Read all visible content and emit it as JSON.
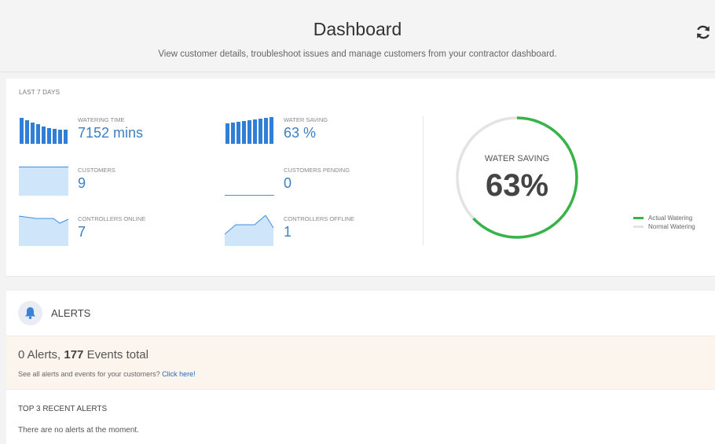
{
  "header": {
    "title": "Dashboard",
    "subtitle": "View customer details, troubleshoot issues and manage customers from your contractor dashboard."
  },
  "stats": {
    "period_label": "LAST 7 DAYS",
    "watering_time": {
      "label": "WATERING TIME",
      "value": "7152 mins"
    },
    "water_saving": {
      "label": "WATER SAVING",
      "value": "63 %"
    },
    "customers": {
      "label": "CUSTOMERS",
      "value": "9"
    },
    "customers_pending": {
      "label": "CUSTOMERS PENDING",
      "value": "0"
    },
    "controllers_online": {
      "label": "CONTROLLERS ONLINE",
      "value": "7"
    },
    "controllers_offline": {
      "label": "CONTROLLERS OFFLINE",
      "value": "1"
    }
  },
  "gauge": {
    "label": "WATER SAVING",
    "value_text": "63%",
    "percent": 63,
    "colors": {
      "actual": "#37b34a",
      "normal": "#e3e3e3"
    }
  },
  "legend": [
    {
      "label": "Actual Watering",
      "color": "#37b34a"
    },
    {
      "label": "Normal Watering",
      "color": "#e3e3e3"
    }
  ],
  "alerts": {
    "title": "ALERTS",
    "alert_count": "0",
    "alerts_word": " Alerts, ",
    "event_count": "177",
    "events_word": " Events total",
    "prompt": "See all alerts and events for your customers? ",
    "link": "Click here!",
    "recent_title": "TOP 3 RECENT ALERTS",
    "empty_message": "There are no alerts at the moment."
  },
  "colors": {
    "accent": "#3c7fc2",
    "sparkline_fill": "#cfe5fa",
    "sparkline_stroke": "#3d8fdf",
    "bar": "#2e7fd5",
    "alert_banner": "#fcf5ee"
  },
  "icons": {
    "refresh": "refresh-icon",
    "bell": "bell-icon"
  }
}
